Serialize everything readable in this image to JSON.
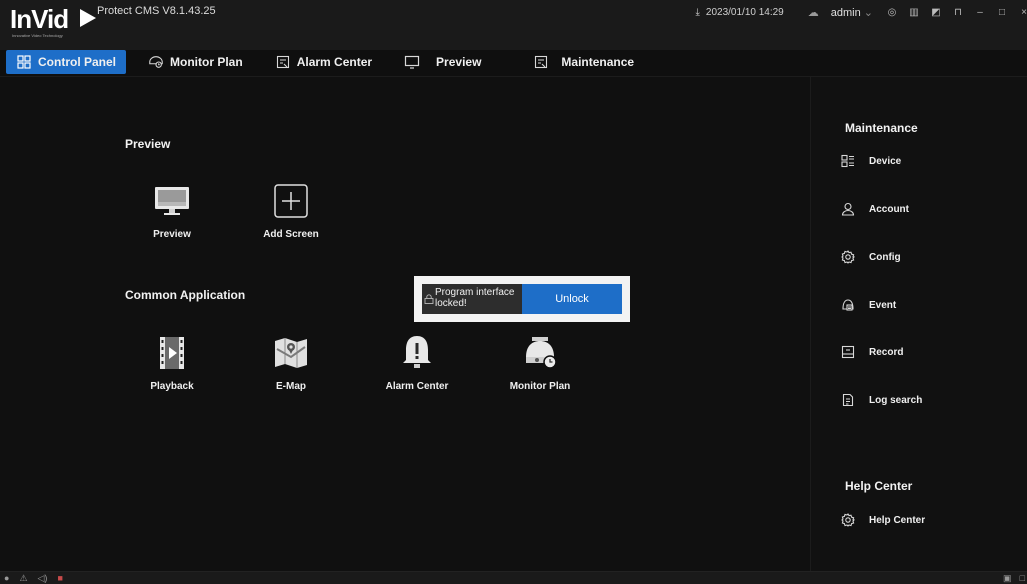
{
  "app": {
    "logo_text": "InVid",
    "logo_sub": "Innovative Video Technology",
    "title": "Protect CMS V8.1.43.25",
    "datetime": "2023/01/10 14:29",
    "user": "admin",
    "user_chevron": "⌄"
  },
  "nav": {
    "tabs": [
      {
        "label": "Control Panel",
        "icon": "grid-icon"
      },
      {
        "label": "Monitor Plan",
        "icon": "monitor-plan-icon"
      },
      {
        "label": "Alarm Center",
        "icon": "alarm-list-icon"
      },
      {
        "label": "Preview",
        "icon": "display-icon"
      },
      {
        "label": "Maintenance",
        "icon": "maintenance-list-icon"
      }
    ]
  },
  "main": {
    "preview_section": "Preview",
    "preview_items": [
      {
        "label": "Preview",
        "icon": "monitor-icon"
      },
      {
        "label": "Add Screen",
        "icon": "plus-box-icon"
      }
    ],
    "common_section": "Common Application",
    "common_items": [
      {
        "label": "Playback",
        "icon": "film-icon"
      },
      {
        "label": "E-Map",
        "icon": "map-icon"
      },
      {
        "label": "Alarm Center",
        "icon": "bell-icon"
      },
      {
        "label": "Monitor Plan",
        "icon": "dome-camera-icon"
      }
    ]
  },
  "lock": {
    "message": "Program interface locked!",
    "button": "Unlock"
  },
  "right_panel": {
    "maintenance_title": "Maintenance",
    "maintenance_items": [
      {
        "label": "Device",
        "icon": "device-icon"
      },
      {
        "label": "Account",
        "icon": "user-icon"
      },
      {
        "label": "Config",
        "icon": "gear-icon"
      },
      {
        "label": "Event",
        "icon": "event-icon"
      },
      {
        "label": "Record",
        "icon": "record-icon"
      },
      {
        "label": "Log search",
        "icon": "log-icon"
      }
    ],
    "help_title": "Help Center",
    "help_items": [
      {
        "label": "Help Center",
        "icon": "help-gear-icon"
      }
    ]
  },
  "colors": {
    "accent": "#1e6ec8",
    "background": "#0f0f0f",
    "panel": "#111111"
  }
}
